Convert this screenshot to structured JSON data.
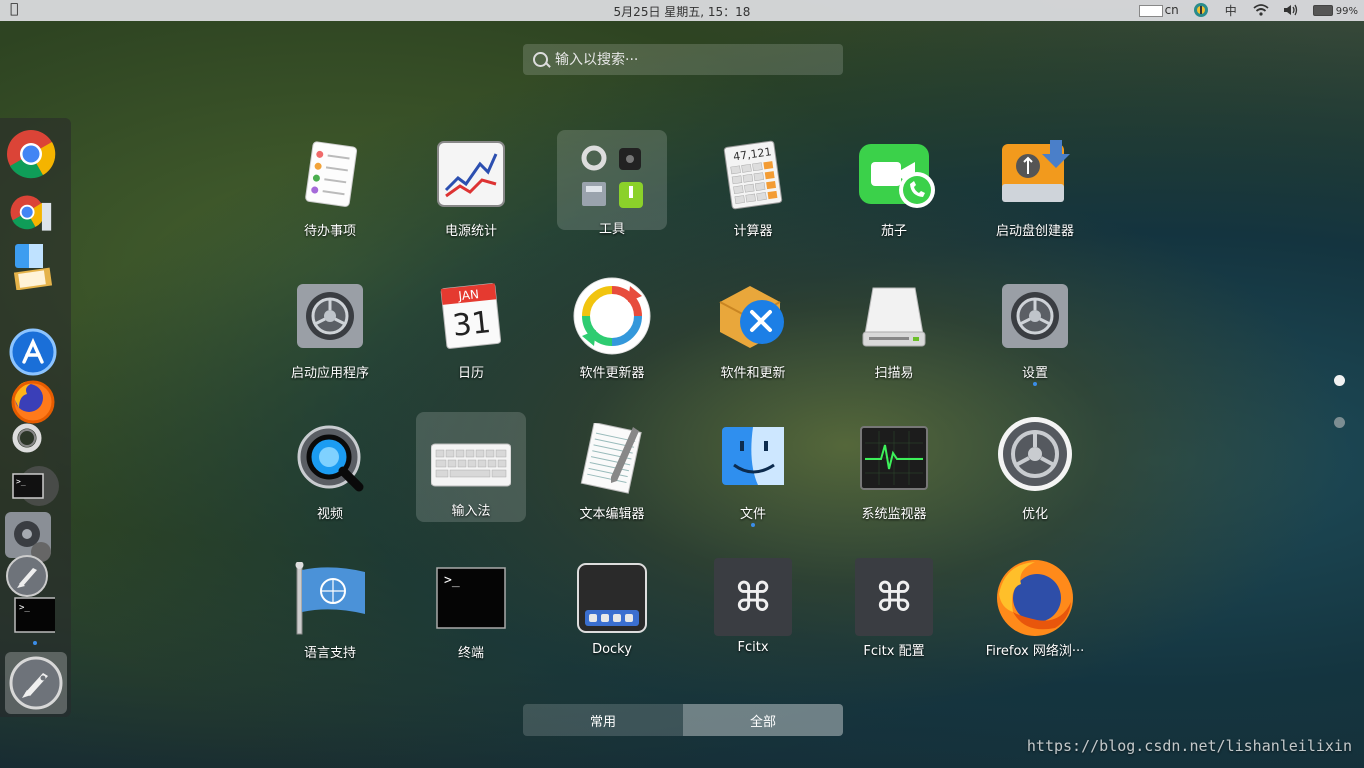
{
  "topbar": {
    "clock": "5月25日 星期五, 15：18",
    "ime_label": "cn",
    "input_method": "中",
    "battery": "99%",
    "icons": [
      "apple-menu-icon",
      "keyboard-layout-icon",
      "fcitx-icon",
      "wifi-icon",
      "volume-icon",
      "battery-icon"
    ]
  },
  "search": {
    "placeholder": "输入以搜索···"
  },
  "dock": {
    "items": [
      {
        "icon": "chrome-icon"
      },
      {
        "icon": "chrome-icon"
      },
      {
        "icon": "finder-icon"
      },
      {
        "icon": "notes-icon"
      },
      {
        "icon": "app-store-icon"
      },
      {
        "icon": "firefox-icon"
      },
      {
        "icon": "update-icon"
      },
      {
        "icon": "terminal-icon"
      },
      {
        "icon": "settings-icon"
      },
      {
        "icon": "launchpad-icon"
      },
      {
        "icon": "terminal-icon"
      },
      {
        "icon": "launchpad-icon"
      }
    ]
  },
  "apps": [
    {
      "label": "待办事项",
      "icon": "reminders-icon",
      "running": false
    },
    {
      "label": "电源统计",
      "icon": "power-stats-icon",
      "running": false
    },
    {
      "label": "工具",
      "icon": "folder-tools-icon",
      "running": false
    },
    {
      "label": "计算器",
      "icon": "calculator-icon",
      "running": false,
      "icon_text": "47,121"
    },
    {
      "label": "茄子",
      "icon": "facetime-icon",
      "running": false
    },
    {
      "label": "启动盘创建器",
      "icon": "usb-creator-icon",
      "running": false
    },
    {
      "label": "启动应用程序",
      "icon": "startup-apps-icon",
      "running": false
    },
    {
      "label": "日历",
      "icon": "calendar-icon",
      "running": false,
      "icon_month": "JAN",
      "icon_day": "31"
    },
    {
      "label": "软件更新器",
      "icon": "software-updater-icon",
      "running": false
    },
    {
      "label": "软件和更新",
      "icon": "software-sources-icon",
      "running": false
    },
    {
      "label": "扫描易",
      "icon": "scanner-icon",
      "running": false
    },
    {
      "label": "设置",
      "icon": "settings-icon",
      "running": true
    },
    {
      "label": "视频",
      "icon": "quicktime-icon",
      "running": false
    },
    {
      "label": "输入法",
      "icon": "keyboard-icon",
      "running": false
    },
    {
      "label": "文本编辑器",
      "icon": "text-editor-icon",
      "running": false
    },
    {
      "label": "文件",
      "icon": "finder-icon",
      "running": true
    },
    {
      "label": "系统监视器",
      "icon": "activity-monitor-icon",
      "running": false
    },
    {
      "label": "优化",
      "icon": "tweaks-icon",
      "running": false
    },
    {
      "label": "语言支持",
      "icon": "language-support-icon",
      "running": false
    },
    {
      "label": "终端",
      "icon": "terminal-icon",
      "running": false
    },
    {
      "label": "Docky",
      "icon": "docky-icon",
      "running": false
    },
    {
      "label": "Fcitx",
      "icon": "fcitx-command-icon",
      "running": false
    },
    {
      "label": "Fcitx 配置",
      "icon": "fcitx-config-icon",
      "running": false
    },
    {
      "label": "Firefox 网络浏···",
      "icon": "firefox-icon",
      "running": false
    }
  ],
  "pages": {
    "count": 2,
    "current": 1
  },
  "tabs": [
    {
      "label": "常用",
      "active": false
    },
    {
      "label": "全部",
      "active": true
    }
  ],
  "watermark": "https://blog.csdn.net/lishanleilixin",
  "colors": {
    "accent": "#3b8de8",
    "topbar": "#dedee2"
  }
}
